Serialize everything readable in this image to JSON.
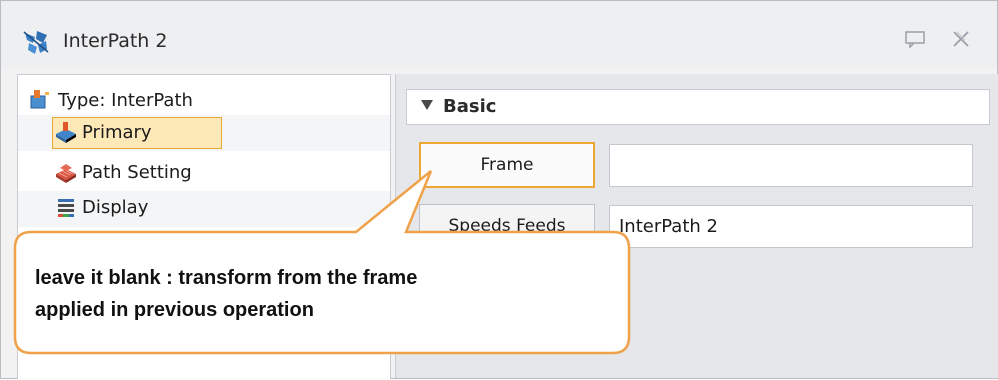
{
  "window": {
    "title": "InterPath 2",
    "title_icon": "interpath-icon",
    "pin_icon": "pin-icon",
    "close_icon": "close-icon"
  },
  "tree": {
    "items": [
      {
        "label": "Type: InterPath",
        "icon": "type-icon"
      },
      {
        "label": "Primary",
        "icon": "primary-icon",
        "selected": true
      },
      {
        "label": "Path Setting",
        "icon": "path-setting-icon"
      },
      {
        "label": "Display",
        "icon": "display-icon"
      }
    ]
  },
  "panel": {
    "section_label": "Basic",
    "rows": [
      {
        "button_label": "Frame",
        "field_value": ""
      },
      {
        "button_label": "Speeds Feeds",
        "field_value": "InterPath 2"
      }
    ]
  },
  "callout": {
    "line1": "leave it blank : transform from the frame",
    "line2": "applied in previous operation"
  },
  "colors": {
    "accent": "#eba832",
    "callout_border": "#f0a24a",
    "selection_bg": "#fde8b7"
  }
}
